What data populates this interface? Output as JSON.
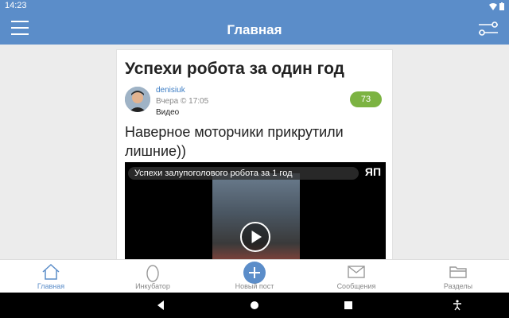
{
  "status": {
    "time": "14:23"
  },
  "appbar": {
    "title": "Главная"
  },
  "post": {
    "title": "Успехи робота за один год",
    "author": "denisiuk",
    "meta": "Вчера © 17:05",
    "tag": "Видео",
    "rating": "73",
    "text": "Наверное моторчики прикрутили лишние))",
    "video": {
      "title": "Успехи залупоголового робота за 1 год",
      "logo": "ЯП"
    }
  },
  "tabs": [
    {
      "label": "Главная",
      "icon": "home-icon"
    },
    {
      "label": "Инкубатор",
      "icon": "egg-icon"
    },
    {
      "label": "Новый пост",
      "icon": "plus-icon"
    },
    {
      "label": "Сообщения",
      "icon": "mail-icon"
    },
    {
      "label": "Разделы",
      "icon": "folder-icon"
    }
  ],
  "colors": {
    "accent": "#5b8dc9",
    "rating": "#7cb342"
  }
}
